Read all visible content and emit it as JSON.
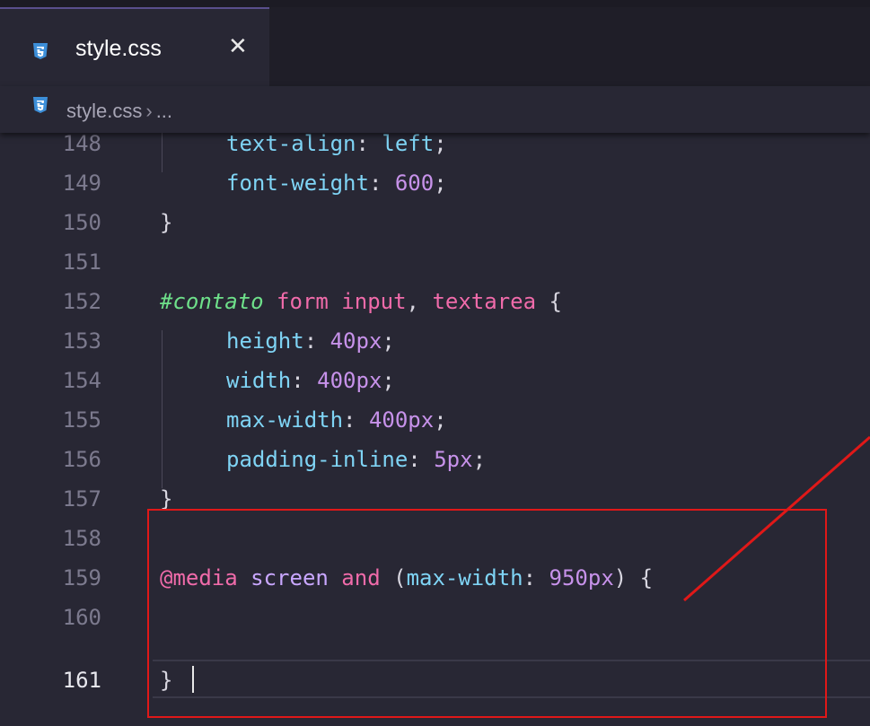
{
  "tab": {
    "icon": "css3-icon",
    "label": "style.css",
    "close_glyph": "✕"
  },
  "breadcrumb": {
    "icon": "css3-icon",
    "file": "style.css",
    "separator": "›",
    "rest": "..."
  },
  "editor": {
    "active_line": "161",
    "lines": [
      {
        "number": "148",
        "parts": [
          "text-align",
          ": ",
          "left",
          ";"
        ]
      },
      {
        "number": "149",
        "parts": [
          "font-weight",
          ": ",
          "600",
          ";"
        ]
      },
      {
        "number": "150",
        "parts": [
          "}"
        ]
      },
      {
        "number": "151",
        "parts": []
      },
      {
        "number": "152",
        "parts": [
          "#contato",
          " ",
          "form",
          " ",
          "input",
          ", ",
          "textarea",
          " {"
        ]
      },
      {
        "number": "153",
        "parts": [
          "height",
          ": ",
          "40px",
          ";"
        ]
      },
      {
        "number": "154",
        "parts": [
          "width",
          ": ",
          "400px",
          ";"
        ]
      },
      {
        "number": "155",
        "parts": [
          "max-width",
          ": ",
          "400px",
          ";"
        ]
      },
      {
        "number": "156",
        "parts": [
          "padding-inline",
          ": ",
          "5px",
          ";"
        ]
      },
      {
        "number": "157",
        "parts": [
          "}"
        ]
      },
      {
        "number": "158",
        "parts": []
      },
      {
        "number": "159",
        "parts": [
          "@media",
          " screen ",
          "and",
          " (",
          "max-width",
          ": ",
          "950px",
          ") {"
        ]
      },
      {
        "number": "160",
        "parts": []
      },
      {
        "number": "161",
        "parts": [
          "}"
        ]
      }
    ]
  },
  "annotation": {
    "box_color": "#e01818",
    "arrow_color": "#e01818"
  }
}
